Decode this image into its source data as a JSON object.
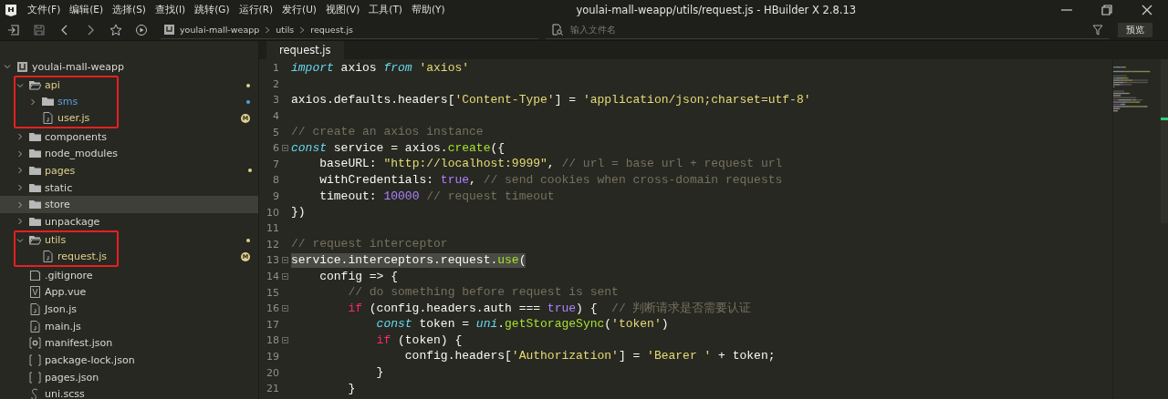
{
  "window": {
    "title": "youlai-mall-weapp/utils/request.js - HBuilder X 2.8.13"
  },
  "menu": [
    "文件(F)",
    "编辑(E)",
    "选择(S)",
    "查找(I)",
    "跳转(G)",
    "运行(R)",
    "发行(U)",
    "视图(V)",
    "工具(T)",
    "帮助(Y)"
  ],
  "breadcrumb": [
    "youlai-mall-weapp",
    "utils",
    "request.js"
  ],
  "search": {
    "placeholder": "输入文件名"
  },
  "preview_button": "预览",
  "tree": {
    "label": "youlai-mall-weapp",
    "expanded": true,
    "children": [
      {
        "label": "api",
        "kind": "folder",
        "expanded": true,
        "highlighted": true,
        "color": "#e0d08c",
        "children": [
          {
            "label": "sms",
            "kind": "folder",
            "expanded": false,
            "color": "#5aa0e0"
          },
          {
            "label": "user.js",
            "kind": "js",
            "color": "#e0d08c",
            "badge": "M"
          }
        ]
      },
      {
        "label": "components",
        "kind": "folder",
        "expanded": false
      },
      {
        "label": "node_modules",
        "kind": "folder",
        "expanded": false
      },
      {
        "label": "pages",
        "kind": "folder",
        "expanded": false,
        "color": "#e0d08c"
      },
      {
        "label": "static",
        "kind": "folder",
        "expanded": false
      },
      {
        "label": "store",
        "kind": "folder",
        "expanded": false,
        "selected": true
      },
      {
        "label": "unpackage",
        "kind": "folder",
        "expanded": false
      },
      {
        "label": "utils",
        "kind": "folder",
        "expanded": true,
        "highlighted": true,
        "color": "#e0d08c",
        "children": [
          {
            "label": "request.js",
            "kind": "js",
            "color": "#e0d08c",
            "badge": "M"
          }
        ]
      },
      {
        "label": ".gitignore",
        "kind": "file"
      },
      {
        "label": "App.vue",
        "kind": "vue"
      },
      {
        "label": "Json.js",
        "kind": "js"
      },
      {
        "label": "main.js",
        "kind": "js"
      },
      {
        "label": "manifest.json",
        "kind": "settings"
      },
      {
        "label": "package-lock.json",
        "kind": "json"
      },
      {
        "label": "pages.json",
        "kind": "json"
      },
      {
        "label": "uni.scss",
        "kind": "scss"
      }
    ]
  },
  "tab": {
    "label": "request.js",
    "selected": true
  },
  "code": [
    {
      "number": "1",
      "tokens": [
        {
          "text": "import",
          "kind": "keyword"
        },
        {
          "text": " axios ",
          "kind": "plain"
        },
        {
          "text": "from ",
          "kind": "keyword"
        },
        {
          "text": "'axios'",
          "kind": "string"
        }
      ]
    },
    {
      "number": "2"
    },
    {
      "number": "3",
      "tokens": [
        {
          "text": "axios.defaults.headers[",
          "kind": "plain"
        },
        {
          "text": "'Content-Type'",
          "kind": "string"
        },
        {
          "text": "] = ",
          "kind": "plain"
        },
        {
          "text": "'application/json;charset=utf-8'",
          "kind": "string"
        }
      ]
    },
    {
      "number": "4"
    },
    {
      "number": "5",
      "tokens": [
        {
          "text": "// create an axios instance",
          "kind": "comment"
        }
      ]
    },
    {
      "number": "6",
      "foldable": true,
      "tokens": [
        {
          "text": "const",
          "kind": "keyword"
        },
        {
          "text": " service = axios.",
          "kind": "plain"
        },
        {
          "text": "create",
          "kind": "function"
        },
        {
          "text": "({",
          "kind": "plain"
        }
      ]
    },
    {
      "number": "7",
      "tokens": [
        {
          "text": "    baseURL: ",
          "kind": "plain"
        },
        {
          "text": "\"http://localhost:9999\"",
          "kind": "string"
        },
        {
          "text": ", ",
          "kind": "plain"
        },
        {
          "text": "// url = base url + request url",
          "kind": "comment"
        }
      ]
    },
    {
      "number": "8",
      "tokens": [
        {
          "text": "    withCredentials: ",
          "kind": "plain"
        },
        {
          "text": "true",
          "kind": "constant"
        },
        {
          "text": ", ",
          "kind": "plain"
        },
        {
          "text": "// send cookies when cross-domain requests",
          "kind": "comment"
        }
      ]
    },
    {
      "number": "9",
      "tokens": [
        {
          "text": "    timeout: ",
          "kind": "plain"
        },
        {
          "text": "10000 ",
          "kind": "constant"
        },
        {
          "text": "// request timeout",
          "kind": "comment"
        }
      ]
    },
    {
      "number": "10",
      "tokens": [
        {
          "text": "})",
          "kind": "plain"
        }
      ]
    },
    {
      "number": "11"
    },
    {
      "number": "12",
      "tokens": [
        {
          "text": "// request interceptor",
          "kind": "comment"
        }
      ]
    },
    {
      "number": "13",
      "foldable": true,
      "current": true,
      "tokens": [
        {
          "text": "service.interceptors.request.",
          "kind": "plain"
        },
        {
          "text": "use",
          "kind": "function"
        },
        {
          "text": "(",
          "kind": "plain"
        }
      ]
    },
    {
      "number": "14",
      "foldable": true,
      "tokens": [
        {
          "text": "    config => {",
          "kind": "plain"
        }
      ]
    },
    {
      "number": "15",
      "tokens": [
        {
          "text": "        // do something before request is sent",
          "kind": "comment"
        }
      ]
    },
    {
      "number": "16",
      "foldable": true,
      "tokens": [
        {
          "text": "        if",
          "kind": "control"
        },
        {
          "text": " (config.headers.auth === ",
          "kind": "plain"
        },
        {
          "text": "true",
          "kind": "constant"
        },
        {
          "text": ") {  ",
          "kind": "plain"
        },
        {
          "text": "// 判断请求是否需要认证",
          "kind": "comment"
        }
      ]
    },
    {
      "number": "17",
      "tokens": [
        {
          "text": "            const",
          "kind": "keyword"
        },
        {
          "text": " token = ",
          "kind": "plain"
        },
        {
          "text": "uni",
          "kind": "keyword"
        },
        {
          "text": ".",
          "kind": "plain"
        },
        {
          "text": "getStorageSync",
          "kind": "function"
        },
        {
          "text": "(",
          "kind": "plain"
        },
        {
          "text": "'token'",
          "kind": "string"
        },
        {
          "text": ")",
          "kind": "plain"
        }
      ]
    },
    {
      "number": "18",
      "foldable": true,
      "tokens": [
        {
          "text": "            if",
          "kind": "control"
        },
        {
          "text": " (token) {",
          "kind": "plain"
        }
      ]
    },
    {
      "number": "19",
      "tokens": [
        {
          "text": "                config.headers[",
          "kind": "plain"
        },
        {
          "text": "'Authorization'",
          "kind": "string"
        },
        {
          "text": "] = ",
          "kind": "plain"
        },
        {
          "text": "'Bearer '",
          "kind": "string"
        },
        {
          "text": " + token;",
          "kind": "plain"
        }
      ]
    },
    {
      "number": "20",
      "tokens": [
        {
          "text": "            }",
          "kind": "plain"
        }
      ]
    },
    {
      "number": "21",
      "tokens": [
        {
          "text": "        }",
          "kind": "plain"
        }
      ]
    }
  ]
}
